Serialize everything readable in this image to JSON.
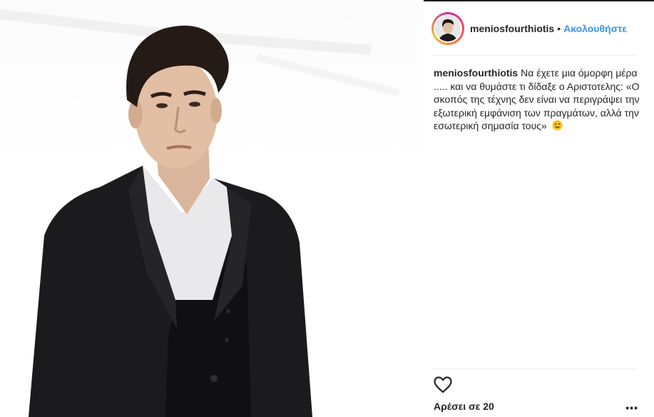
{
  "post": {
    "username": "meniosfourthiotis",
    "separator": "•",
    "follow_label": "Ακολουθήστε",
    "caption_username": "meniosfourthiotis",
    "caption_text": "Να έχετε μια όμορφη μέρα ..... και να θυμάστε τι δίδαξε ο Αριστοτελης: «Ο σκοπός της τέχνης δεν είναι να περιγράψει την εξωτερική εμφάνιση των πραγμάτων, αλλά την εσωτερική σημασία τους»",
    "caption_emoji": "winking-face-emoji",
    "likes_label": "Αρέσει σε 20",
    "more_label": "•••"
  },
  "icons": {
    "like": "heart-outline-icon",
    "more": "more-options-icon",
    "avatar": "profile-avatar"
  },
  "colors": {
    "follow_blue": "#3897f0",
    "text": "#262626",
    "divider": "#efefef",
    "avatar_ring": "#d6249f"
  }
}
